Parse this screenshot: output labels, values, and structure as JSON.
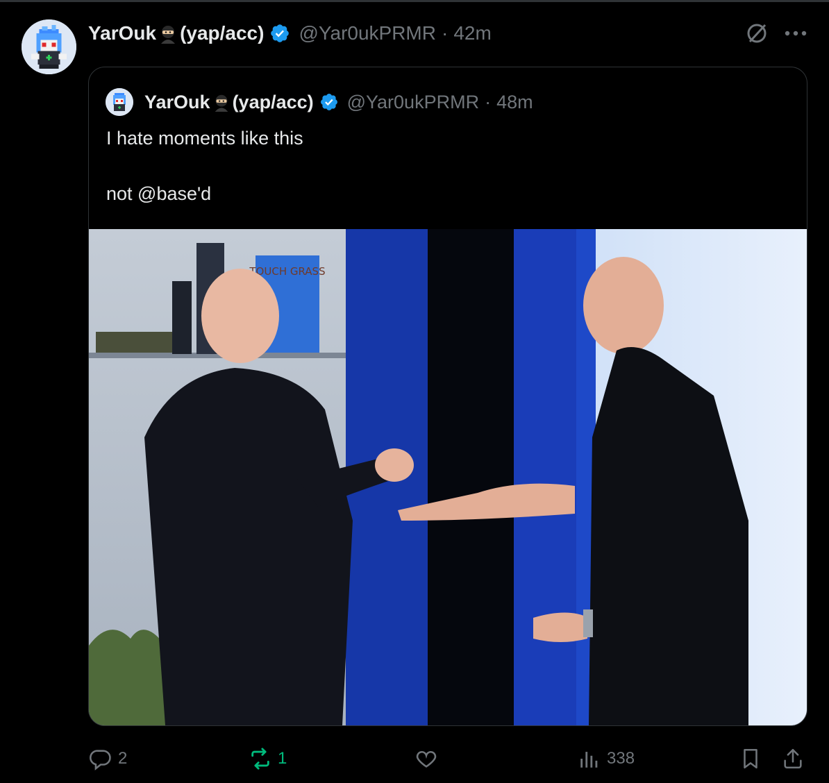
{
  "tweet": {
    "display_name": "YarOuk",
    "name_suffix": "(yap/acc)",
    "handle": "@Yar0ukPRMR",
    "separator": "·",
    "time": "42m"
  },
  "quoted_tweet": {
    "display_name": "YarOuk",
    "name_suffix": "(yap/acc)",
    "handle": "@Yar0ukPRMR",
    "separator": "·",
    "time": "48m",
    "text_line_1": "I hate moments like this",
    "text_line_2": "not @base'd",
    "image_sign_text": "TOUCH GRASS"
  },
  "actions": {
    "reply_count": "2",
    "repost_count": "1",
    "like_count": "",
    "views_count": "338"
  },
  "colors": {
    "verified": "#1d9bf0",
    "muted": "#71767b",
    "repost_active": "#00ba7c",
    "background": "#000000"
  },
  "icons": [
    "verified-badge-icon",
    "ninja-emoji-icon",
    "grok-icon",
    "more-icon",
    "reply-icon",
    "repost-icon",
    "like-icon",
    "views-icon",
    "bookmark-icon",
    "share-icon"
  ]
}
